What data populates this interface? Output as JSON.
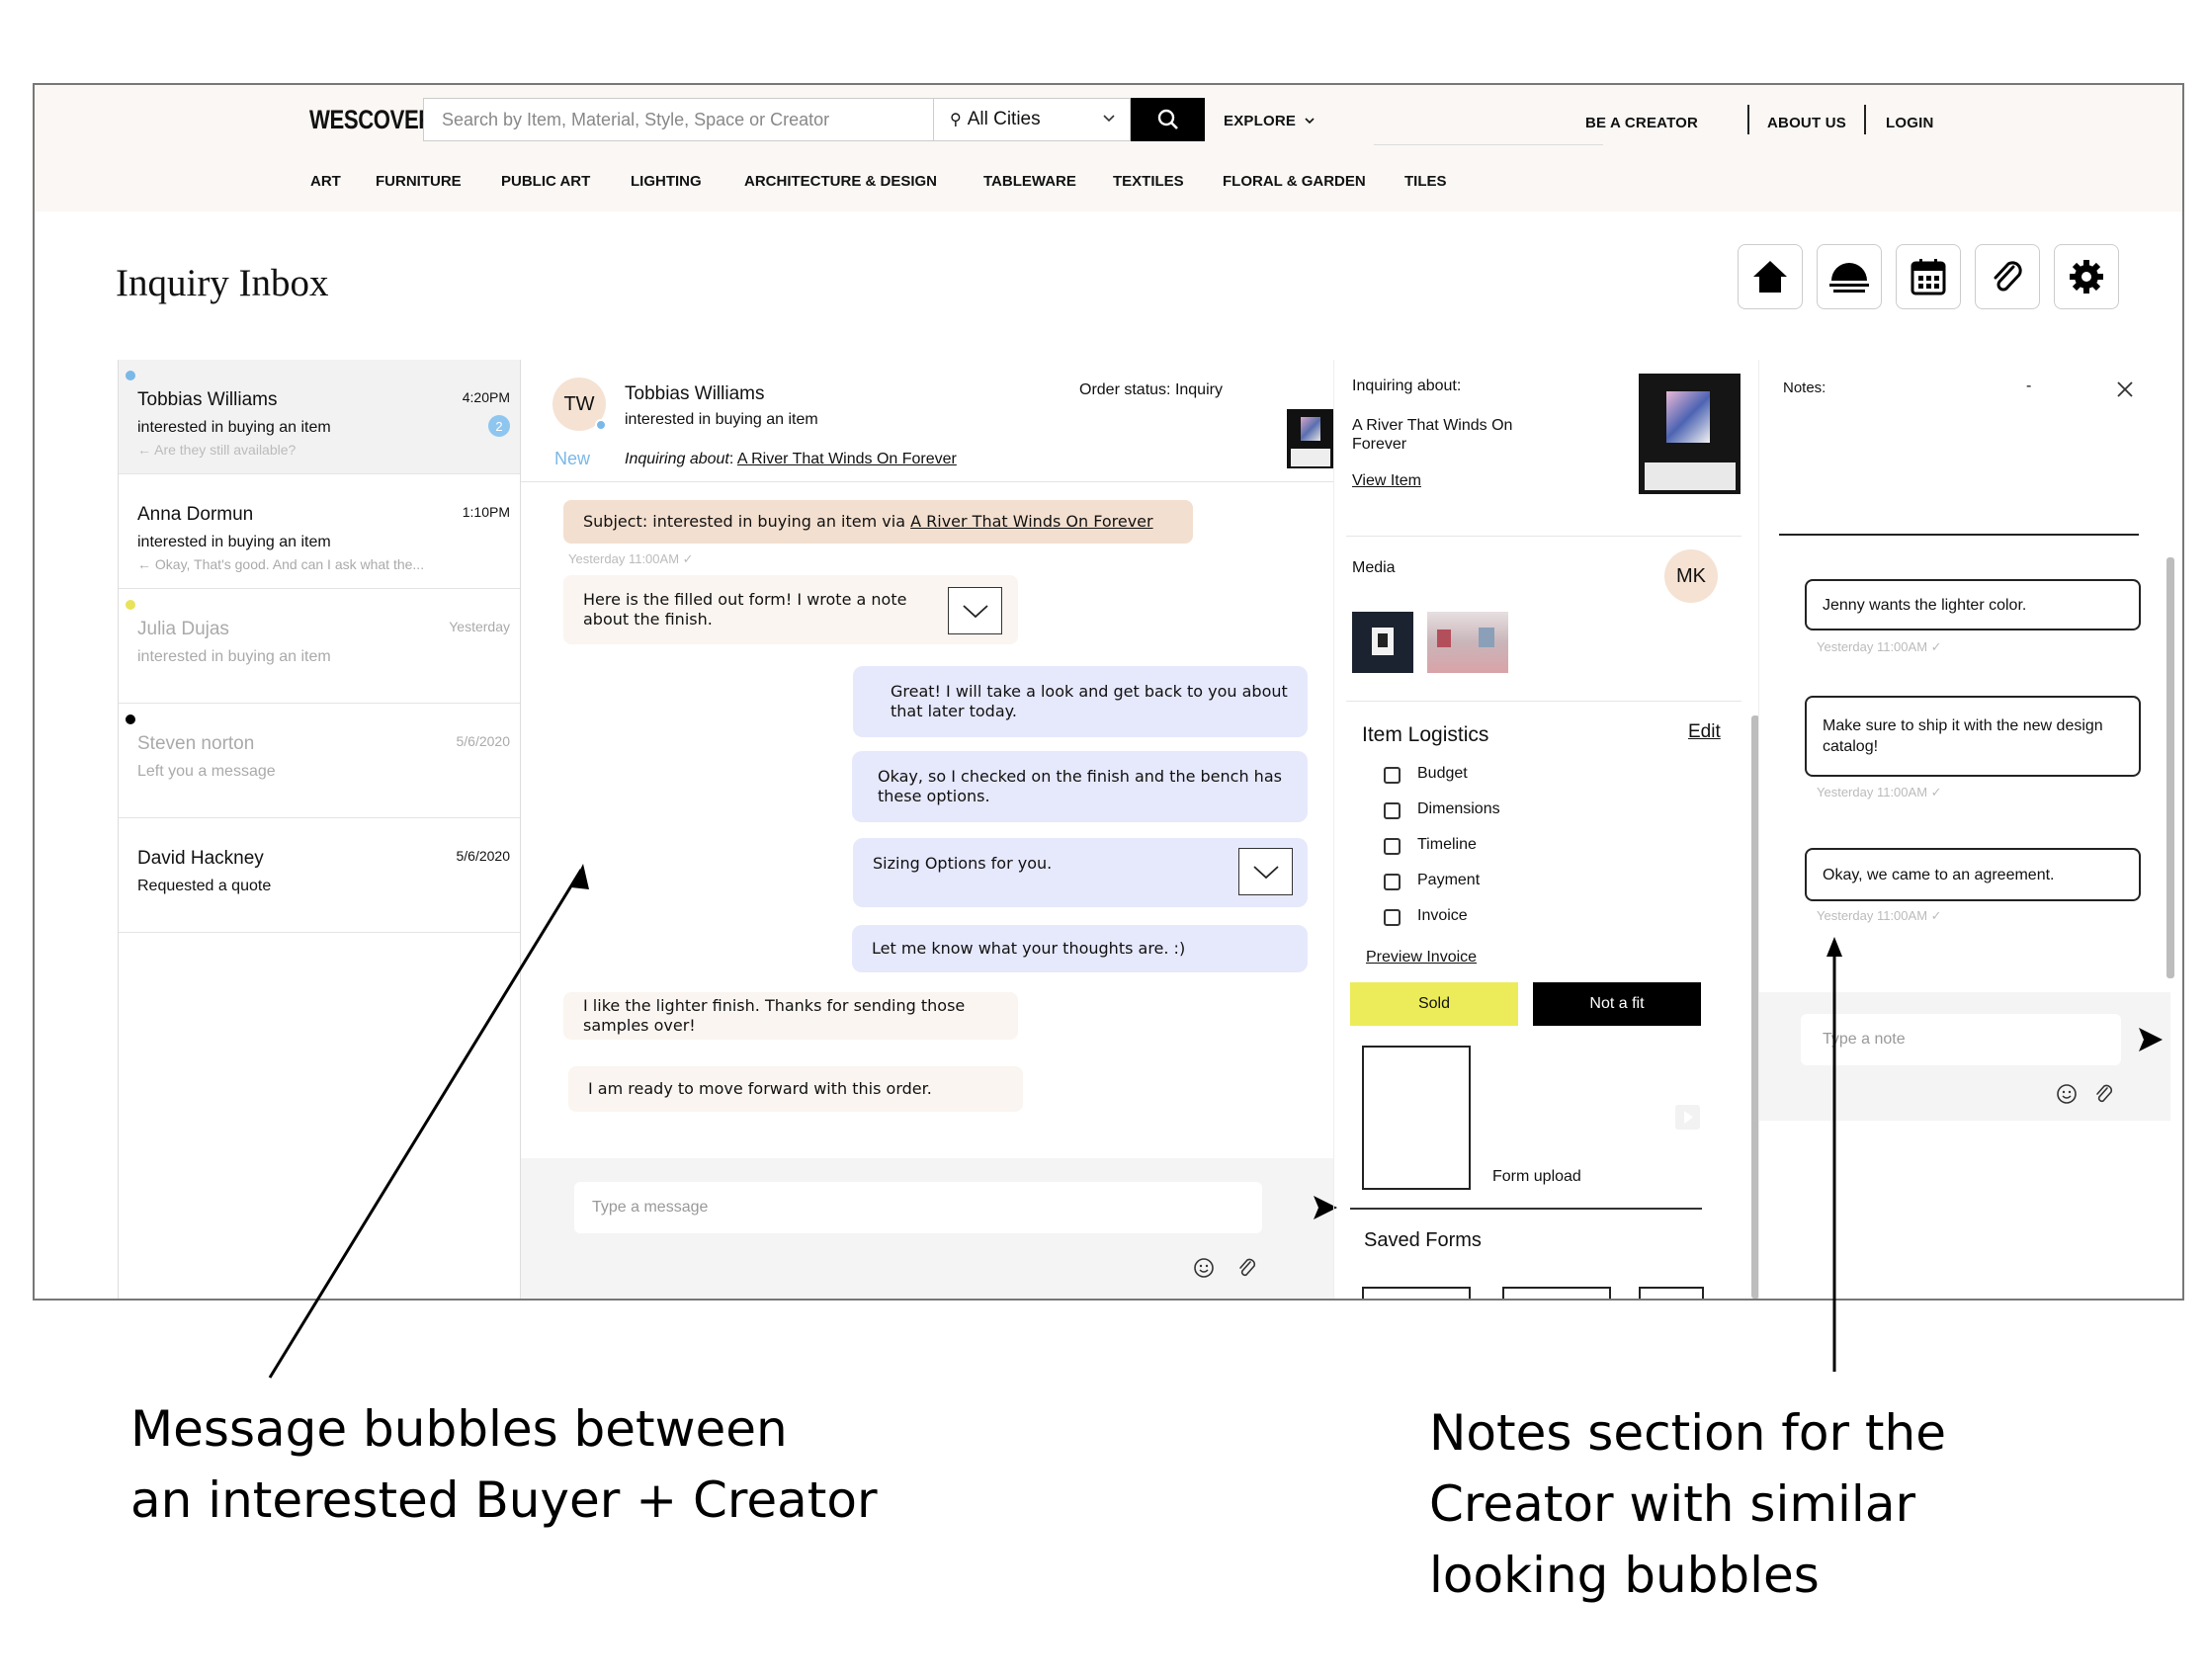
{
  "header": {
    "logo": "WESCOVER",
    "search_placeholder": "Search by Item, Material, Style, Space or Creator",
    "city": "All Cities",
    "explore": "EXPLORE",
    "be_creator": "BE A CREATOR",
    "about": "ABOUT US",
    "login": "LOGIN",
    "categories": [
      "ART",
      "FURNITURE",
      "PUBLIC ART",
      "LIGHTING",
      "ARCHITECTURE & DESIGN",
      "TABLEWARE",
      "TEXTILES",
      "FLORAL & GARDEN",
      "TILES"
    ]
  },
  "page_title": "Inquiry Inbox",
  "conversations": [
    {
      "name": "Tobbias Williams",
      "time": "4:20PM",
      "subject": "interested in buying an item",
      "preview": "← Are they still available?",
      "badge": "2",
      "dot_color": "#7ab8e8"
    },
    {
      "name": "Anna Dormun",
      "time": "1:10PM",
      "subject": "interested in buying an item",
      "preview": "← Okay, That's good. And can I ask what the..."
    },
    {
      "name": "Julia Dujas",
      "time": "Yesterday",
      "subject": "interested in buying an item",
      "preview": "",
      "dot_color": "#e8e35a"
    },
    {
      "name": "Steven norton",
      "time": "5/6/2020",
      "subject": "Left you a message",
      "preview": "",
      "dot_color": "#000000"
    },
    {
      "name": "David Hackney",
      "time": "5/6/2020",
      "subject": "Requested a quote",
      "preview": ""
    }
  ],
  "chat": {
    "initials": "TW",
    "name": "Tobbias Williams",
    "subject_line": "interested in buying an item",
    "status_label": "Order status:",
    "status_value": "Inquiry",
    "new_label": "New",
    "inquiring_label": "Inquiring about",
    "item_name": "A River That Winds On Forever",
    "subject_prefix": "Subject: interested in buying an item via",
    "subject_time": "Yesterday 11:00AM ✓",
    "messages": [
      {
        "text": "Here is the filled out form! I wrote a note about the finish."
      },
      {
        "text": "Great! I will take a look and get back to you about that later today."
      },
      {
        "text": "Okay, so I checked on the finish and the bench has these options."
      },
      {
        "text": "Sizing Options for you."
      },
      {
        "text": "Let me know what your thoughts are. :)"
      },
      {
        "text": "I like the lighter finish. Thanks for sending those samples over!"
      },
      {
        "text": "I am ready to move forward with this order."
      }
    ],
    "input_placeholder": "Type a message"
  },
  "details": {
    "inquiring_label": "Inquiring about:",
    "item_name": "A River That Winds On Forever",
    "view_item": "View Item",
    "media_label": "Media",
    "media_initials": "MK",
    "logistics_title": "Item Logistics",
    "edit": "Edit",
    "checklist": [
      "Budget",
      "Dimensions",
      "Timeline",
      "Payment",
      "Invoice"
    ],
    "preview_invoice": "Preview Invoice",
    "sold": "Sold",
    "not_fit": "Not a fit",
    "form_upload": "Form upload",
    "saved_forms": "Saved Forms",
    "sold_color": "#ecec5a"
  },
  "notes": {
    "title": "Notes:",
    "dash": "-",
    "items": [
      {
        "text": "Jenny wants the lighter color.",
        "time": "Yesterday 11:00AM ✓"
      },
      {
        "text": "Make sure to ship it with the new design catalog!",
        "time": "Yesterday 11:00AM ✓"
      },
      {
        "text": "Okay, we came to an agreement.",
        "time": "Yesterday 11:00AM ✓"
      }
    ],
    "input_placeholder": "Type a note"
  },
  "annotations": {
    "left": [
      "Message bubbles between",
      "an interested Buyer + Creator"
    ],
    "right": [
      "Notes section for the",
      "Creator with similar",
      "looking bubbles"
    ]
  }
}
